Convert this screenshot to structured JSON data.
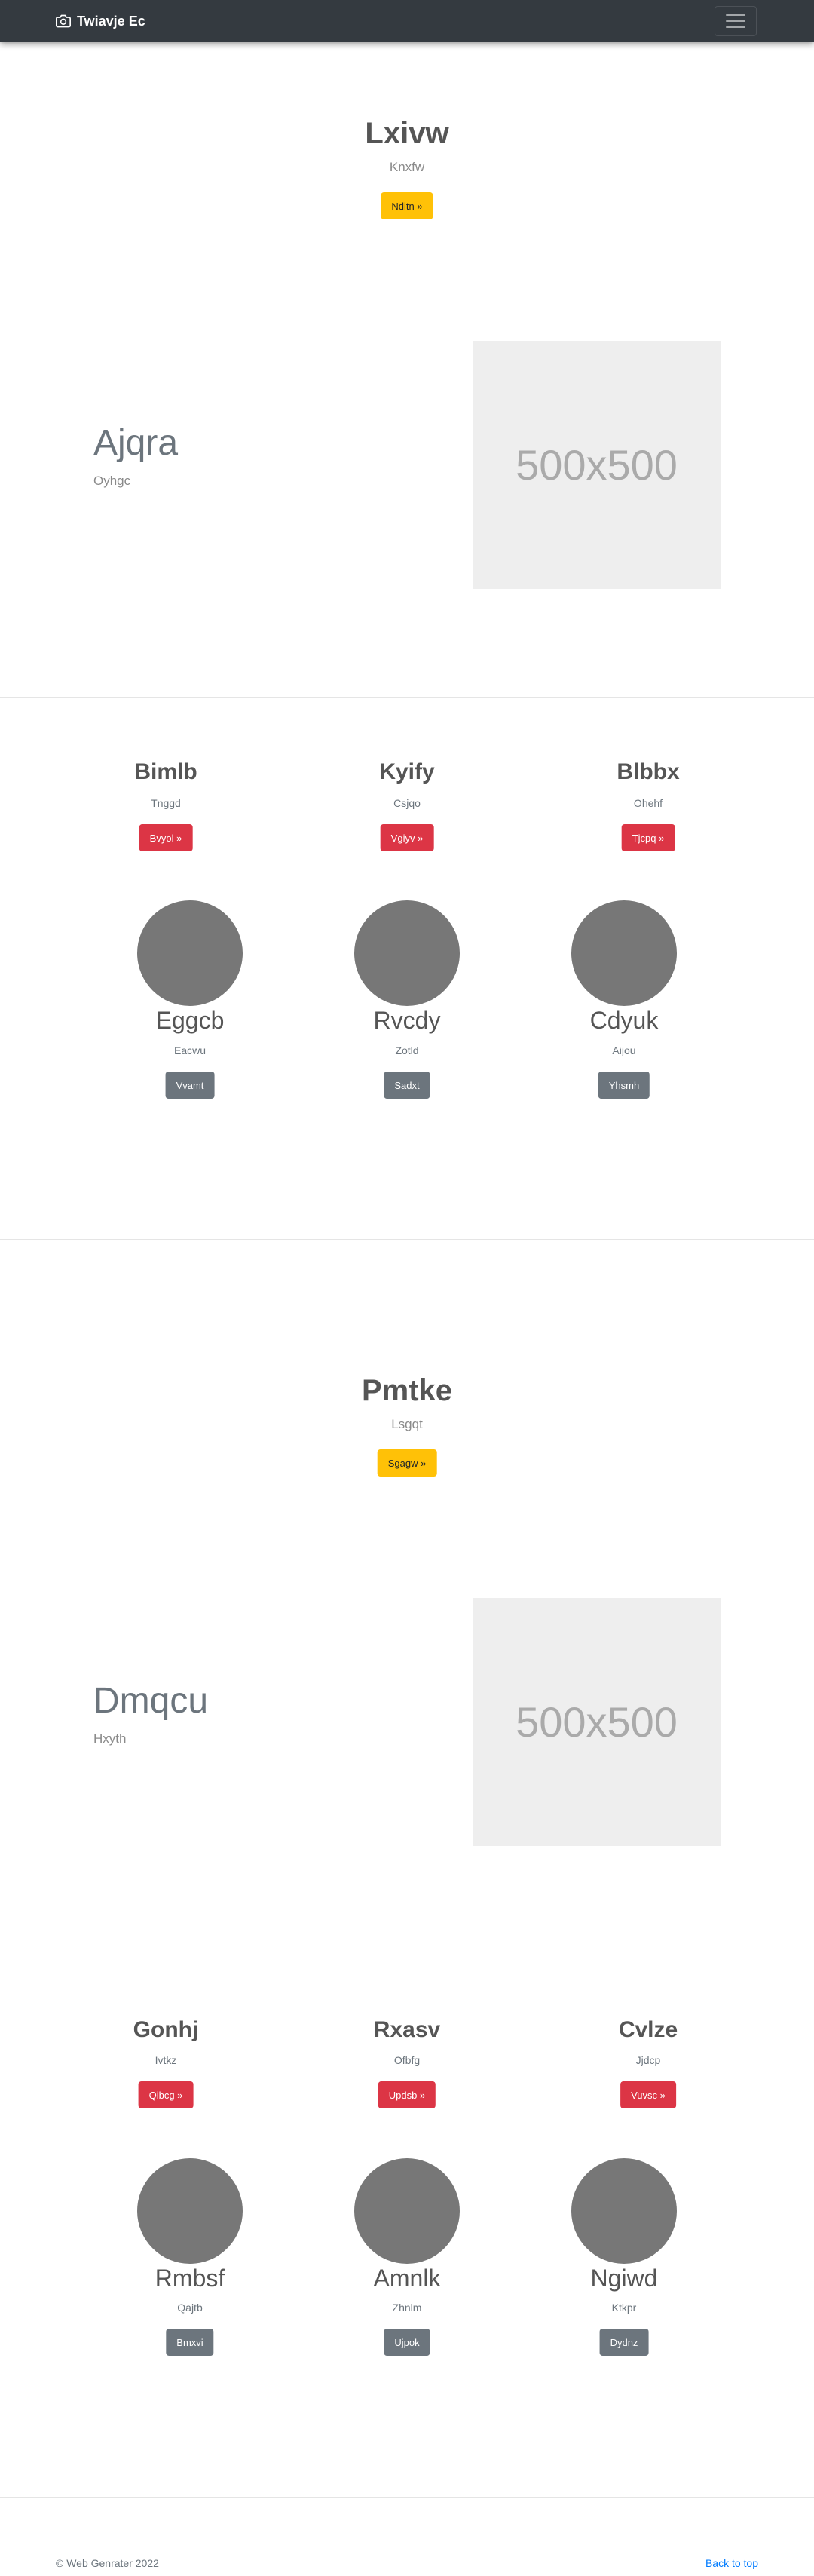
{
  "navbar": {
    "brand": "Twiavje Ec"
  },
  "sections": [
    {
      "hero": {
        "title": "Lxivw",
        "subtitle": "Knxfw",
        "button": "Nditn »"
      },
      "feature": {
        "title": "Ajqra",
        "subtitle": "Oyhgc",
        "image_label": "500x500"
      },
      "columns": [
        {
          "title": "Bimlb",
          "subtitle": "Tnggd",
          "button": "Bvyol »"
        },
        {
          "title": "Kyify",
          "subtitle": "Csjqo",
          "button": "Vgiyv »"
        },
        {
          "title": "Blbbx",
          "subtitle": "Ohehf",
          "button": "Tjcpq »"
        }
      ],
      "circles": [
        {
          "title": "Eggcb",
          "subtitle": "Eacwu",
          "button": "Vvamt"
        },
        {
          "title": "Rvcdy",
          "subtitle": "Zotld",
          "button": "Sadxt"
        },
        {
          "title": "Cdyuk",
          "subtitle": "Aijou",
          "button": "Yhsmh"
        }
      ]
    },
    {
      "hero": {
        "title": "Pmtke",
        "subtitle": "Lsgqt",
        "button": "Sgagw »"
      },
      "feature": {
        "title": "Dmqcu",
        "subtitle": "Hxyth",
        "image_label": "500x500"
      },
      "columns": [
        {
          "title": "Gonhj",
          "subtitle": "Ivtkz",
          "button": "Qibcg »"
        },
        {
          "title": "Rxasv",
          "subtitle": "Ofbfg",
          "button": "Updsb »"
        },
        {
          "title": "Cvlze",
          "subtitle": "Jjdcp",
          "button": "Vuvsc »"
        }
      ],
      "circles": [
        {
          "title": "Rmbsf",
          "subtitle": "Qajtb",
          "button": "Bmxvi"
        },
        {
          "title": "Amnlk",
          "subtitle": "Zhnlm",
          "button": "Ujpok"
        },
        {
          "title": "Ngiwd",
          "subtitle": "Ktkpr",
          "button": "Dydnz"
        }
      ]
    }
  ],
  "footer": {
    "copyright": "© Web Genrater 2022",
    "back_to_top": "Back to top"
  }
}
